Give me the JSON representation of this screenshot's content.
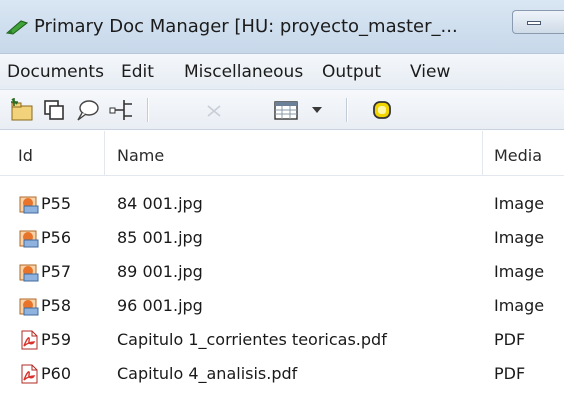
{
  "window": {
    "title": "Primary Doc Manager [HU: proyecto_master_..."
  },
  "menu": [
    "Documents",
    "Edit",
    "Miscellaneous",
    "Output",
    "View"
  ],
  "toolbar": {
    "icons": [
      "new-document-icon",
      "copy-document-icon",
      "comment-icon",
      "tree-structure-icon",
      "delete-icon",
      "table-view-icon",
      "highlight-icon"
    ]
  },
  "table": {
    "headers": {
      "id": "Id",
      "name": "Name",
      "media": "Media"
    },
    "rows": [
      {
        "id": "P55",
        "name": "84 001.jpg",
        "media": "Image",
        "type": "image"
      },
      {
        "id": "P56",
        "name": "85 001.jpg",
        "media": "Image",
        "type": "image"
      },
      {
        "id": "P57",
        "name": "89 001.jpg",
        "media": "Image",
        "type": "image"
      },
      {
        "id": "P58",
        "name": "96 001.jpg",
        "media": "Image",
        "type": "image"
      },
      {
        "id": "P59",
        "name": "Capitulo 1_corrientes teoricas.pdf",
        "media": "PDF",
        "type": "pdf"
      },
      {
        "id": "P60",
        "name": "Capitulo 4_analisis.pdf",
        "media": "PDF",
        "type": "pdf"
      }
    ]
  },
  "colors": {
    "title_bar": "#c7d8ea",
    "pdf_icon": "#d8322a",
    "image_icon": "#e8742b",
    "highlight_icon": "#f2d500"
  }
}
